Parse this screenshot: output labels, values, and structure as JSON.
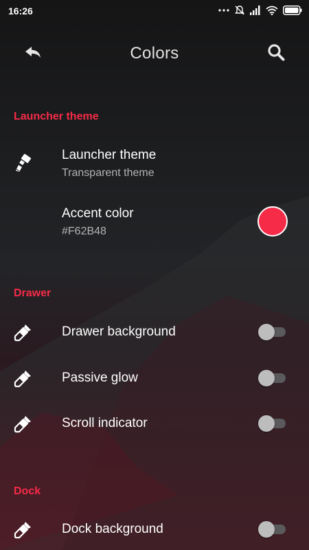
{
  "status_bar": {
    "time": "16:26",
    "icons": [
      "more-dots-icon",
      "alarm-off-icon",
      "signal-icon",
      "wifi-icon",
      "battery-icon"
    ]
  },
  "toolbar": {
    "title": "Colors",
    "back_icon": "reply-arrow-icon",
    "search_icon": "search-icon"
  },
  "sections": {
    "launcher": {
      "header": "Launcher theme",
      "theme_title": "Launcher theme",
      "theme_value": "Transparent theme",
      "accent_title": "Accent color",
      "accent_value": "#F62B48"
    },
    "drawer": {
      "header": "Drawer",
      "items": [
        {
          "label": "Drawer background",
          "enabled": false
        },
        {
          "label": "Passive glow",
          "enabled": false
        },
        {
          "label": "Scroll indicator",
          "enabled": false
        }
      ]
    },
    "dock": {
      "header": "Dock",
      "items": [
        {
          "label": "Dock background",
          "enabled": false
        }
      ]
    }
  },
  "colors": {
    "accent": "#F62B48",
    "section_header": "#F62B48",
    "text_primary": "#FFFFFF",
    "text_secondary": "#B4B4B6"
  }
}
